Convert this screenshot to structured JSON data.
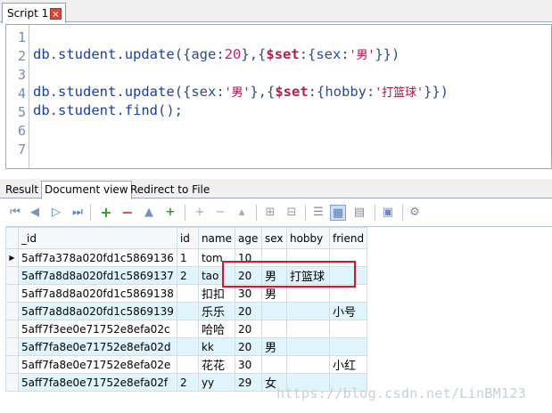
{
  "script_tab": {
    "label": "Script 1",
    "close": "×"
  },
  "editor": {
    "line_numbers": [
      "1",
      "2",
      "3",
      "4",
      "5",
      "6",
      "7"
    ],
    "lines": [
      {
        "db": "db",
        "dot1": ".",
        "coll": "student",
        "dot2": ".",
        "fn": "update",
        "args1": "({age:",
        "num": "20",
        "args2": "},{",
        "op": "$set",
        "args3": ":{sex:",
        "str": "'男'",
        "args4": "}})"
      },
      {
        "db": "db",
        "dot1": ".",
        "coll": "student",
        "dot2": ".",
        "fn": "update",
        "args1": "({sex:",
        "str1": "'男'",
        "args2": "},{",
        "op": "$set",
        "args3": ":{hobby:",
        "str2": "'打篮球'",
        "args4": "}})"
      },
      {
        "db": "db",
        "dot1": ".",
        "coll": "student",
        "dot2": ".",
        "fn": "find",
        "args1": "();"
      }
    ]
  },
  "result_tabs": [
    "Result",
    "Document view",
    "Redirect to File"
  ],
  "active_result_tab": "Document view",
  "toolbar_icons": [
    "first-icon",
    "prev-icon",
    "next-icon",
    "last-icon",
    "add-icon",
    "remove-icon",
    "up-icon",
    "add-copy-icon",
    "insert-row-icon",
    "delete-row-icon",
    "column-icon",
    "grid-icon",
    "grid-remove-icon",
    "tree-view-icon",
    "table-view-icon",
    "text-view-icon",
    "export-icon",
    "settings-icon"
  ],
  "table": {
    "columns": [
      "_id",
      "id",
      "name",
      "age",
      "sex",
      "hobby",
      "friend"
    ],
    "rows": [
      [
        "5aff7a378a020fd1c5869136",
        "1",
        "tom",
        "10",
        "",
        "",
        ""
      ],
      [
        "5aff7a8d8a020fd1c5869137",
        "2",
        "tao",
        "20",
        "男",
        "打篮球",
        ""
      ],
      [
        "5aff7a8d8a020fd1c5869138",
        "",
        "扣扣",
        "30",
        "男",
        "",
        ""
      ],
      [
        "5aff7a8d8a020fd1c5869139",
        "",
        "乐乐",
        "20",
        "",
        "",
        "小号"
      ],
      [
        "5aff7f3ee0e71752e8efa02c",
        "",
        "哈哈",
        "20",
        "",
        "",
        ""
      ],
      [
        "5aff7fa8e0e71752e8efa02d",
        "",
        "kk",
        "20",
        "男",
        "",
        ""
      ],
      [
        "5aff7fa8e0e71752e8efa02e",
        "",
        "花花",
        "30",
        "",
        "",
        "小红"
      ],
      [
        "5aff7fa8e0e71752e8efa02f",
        "2",
        "yy",
        "29",
        "女",
        "",
        ""
      ]
    ]
  },
  "watermark": "https://blog.csdn.net/LinBM123",
  "colors": {
    "highlight_box": "#e0141e",
    "alt_row": "#dff4fb",
    "keyword": "#1a3ea8",
    "number": "#c81d7a",
    "operator": "#b0204a"
  }
}
